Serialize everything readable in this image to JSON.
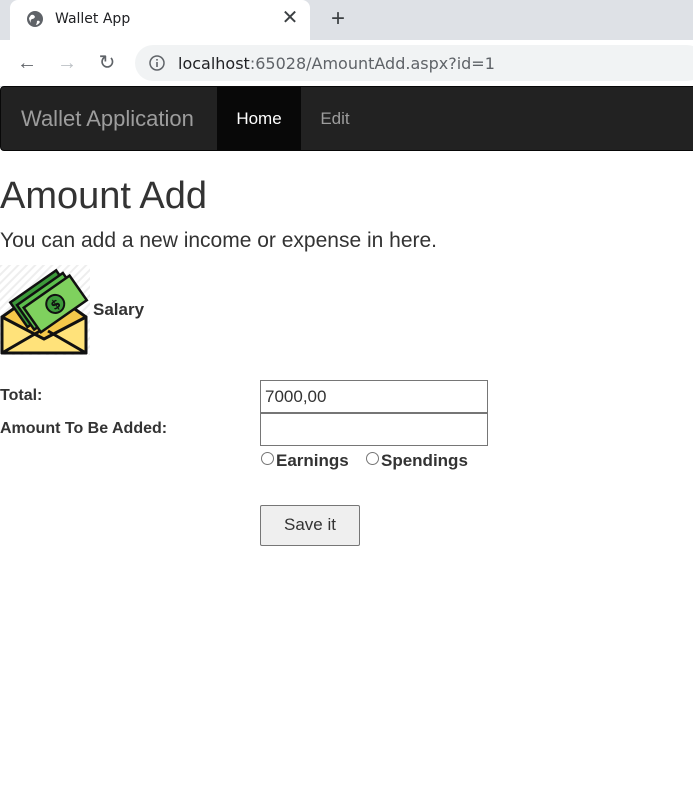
{
  "browser": {
    "tab_title": "Wallet App",
    "tab_close": "✕",
    "new_tab": "+",
    "url_host": "localhost",
    "url_path": ":65028/AmountAdd.aspx?id=1",
    "back": "←",
    "forward": "→",
    "reload": "↻"
  },
  "navbar": {
    "brand": "Wallet Application",
    "items": [
      {
        "label": "Home",
        "active": true
      },
      {
        "label": "Edit",
        "active": false
      }
    ]
  },
  "page": {
    "title": "Amount Add",
    "subtitle": "You can add a new income or expense in here."
  },
  "card": {
    "label": "Salary",
    "icon": "money-envelope-icon"
  },
  "form": {
    "total_label": "Total:",
    "total_value": "7000,00",
    "amount_label": "Amount To Be Added:",
    "amount_value": "",
    "radio_earnings": "Earnings",
    "radio_spendings": "Spendings",
    "save_label": "Save it"
  },
  "colors": {
    "navbar_bg": "#222222",
    "navbar_active": "#080808",
    "text": "#333333"
  }
}
